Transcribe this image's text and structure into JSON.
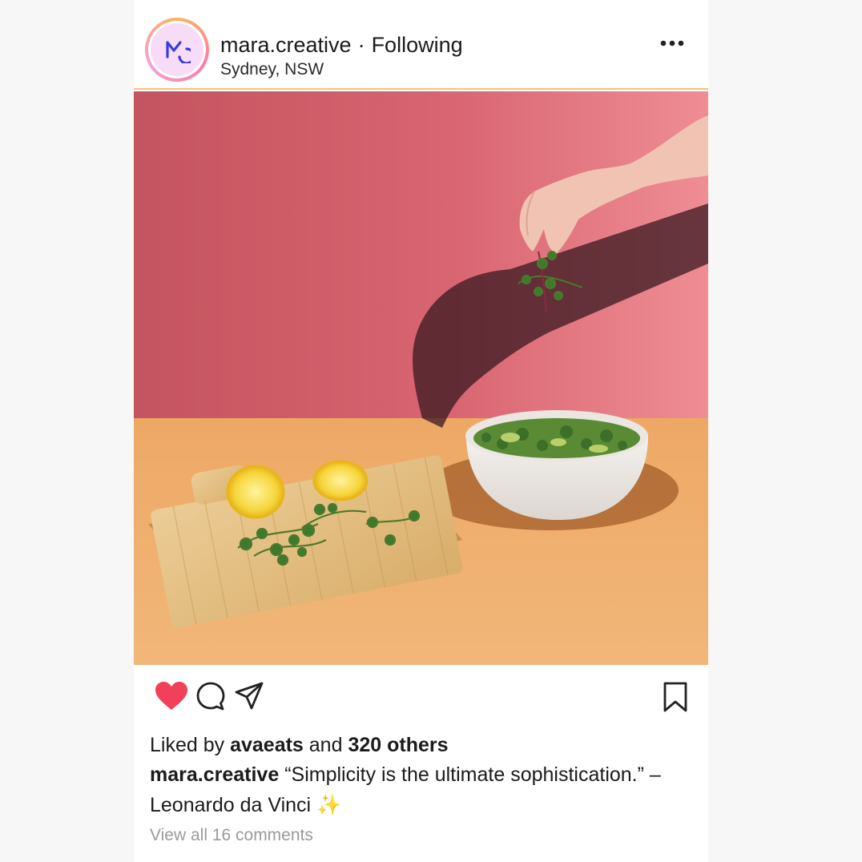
{
  "post": {
    "username": "mara.creative",
    "separator": "·",
    "follow_status": "Following",
    "location": "Sydney, NSW",
    "avatar_initials": "MC",
    "more_icon": "ellipsis-icon",
    "photo_alt": "Hand sprinkling microgreens over a white bowl of salad beside a bamboo board with lemon halves"
  },
  "actions": {
    "like_icon": "heart-icon",
    "like_color": "#f0405a",
    "comment_icon": "comment-icon",
    "share_icon": "send-icon",
    "save_icon": "bookmark-icon"
  },
  "likes": {
    "prefix": "Liked by",
    "user": "avaeats",
    "middle": "and",
    "count": "320 others"
  },
  "caption": {
    "username": "mara.creative",
    "text": "“Simplicity is the ultimate sophistication.” – Leonardo da Vinci ✨"
  },
  "comments": {
    "link": "View all 16 comments"
  }
}
